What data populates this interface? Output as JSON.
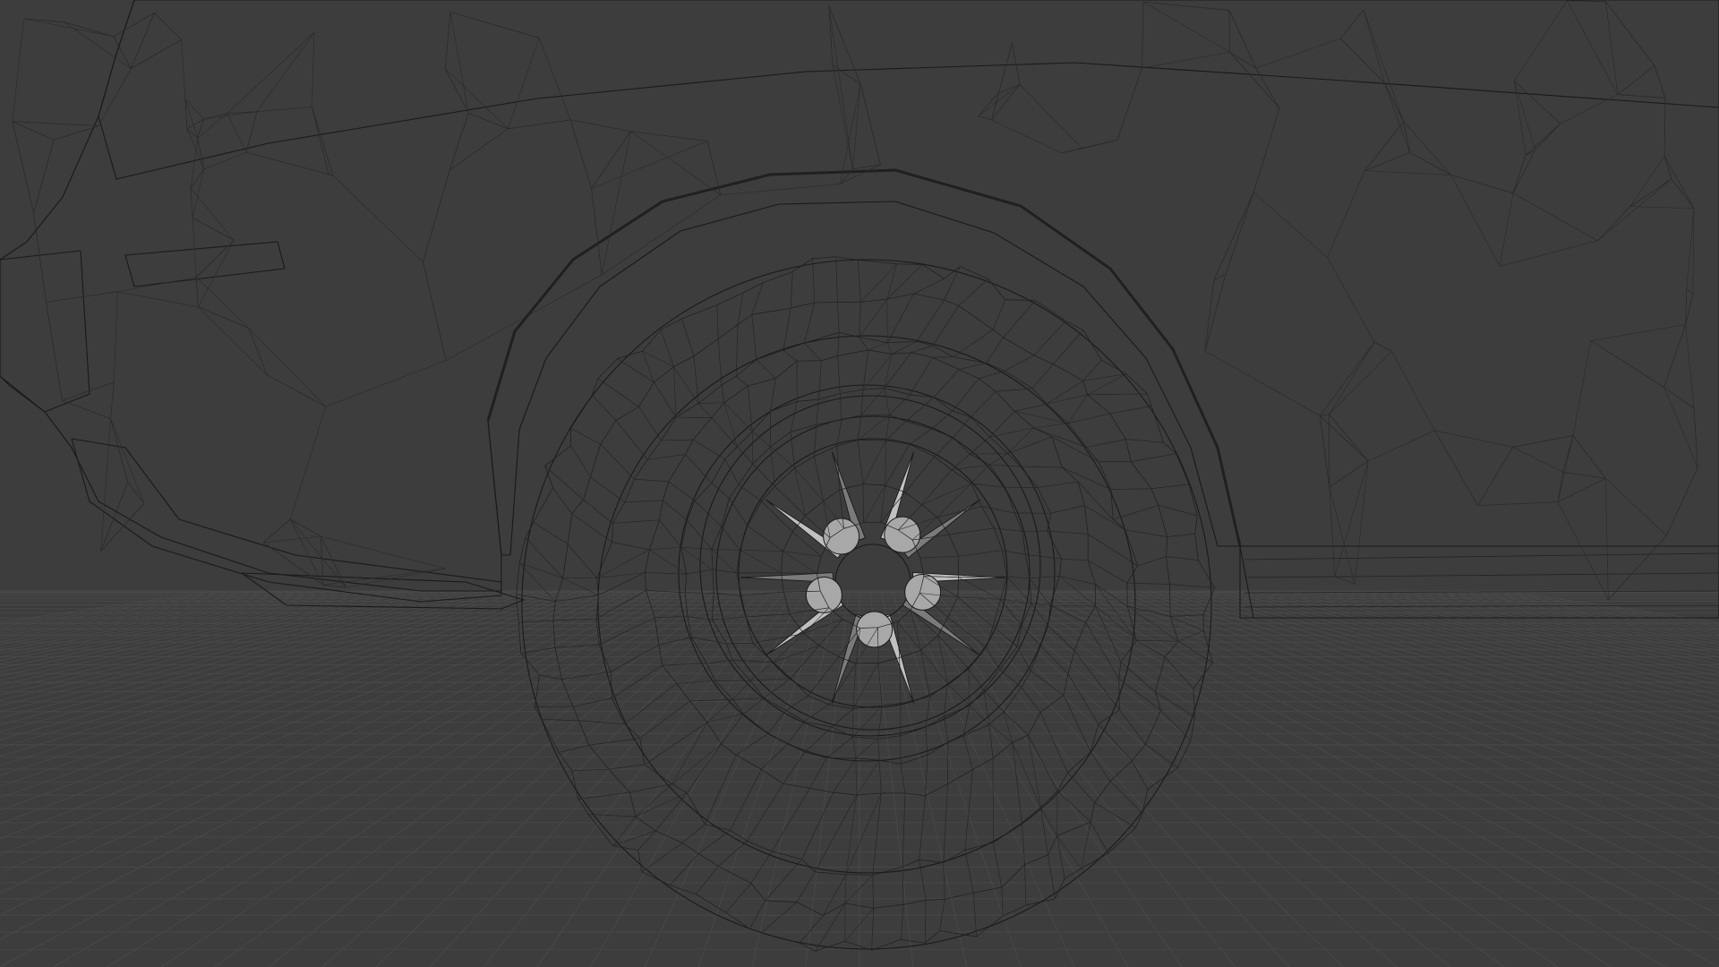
{
  "viewport": {
    "mode": "3d-viewport",
    "shading": "solid-wireframe-overlay",
    "subject": "car-rear-wheel-mesh",
    "colors": {
      "background": "#3d3d3d",
      "grid_line": "#4a4a4a",
      "grid_line_major": "#555555",
      "body_light": "#b9b9b9",
      "body_mid": "#a7a7a7",
      "body_shadow": "#6e6e6e",
      "wheel_arch_inner": "#4e4d4b",
      "tire": "#c4c4c4",
      "rim": "#b0b0b0",
      "hub": "#8a8a8a",
      "edge": "#1a1a1a"
    }
  }
}
